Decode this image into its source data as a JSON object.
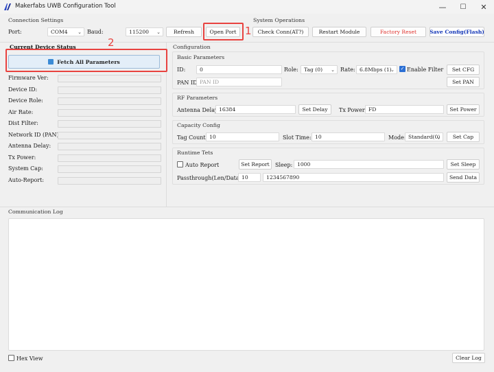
{
  "window": {
    "title": "Makerfabs UWB Configuration Tool",
    "controls": {
      "minimize": "—",
      "maximize": "☐",
      "close": "✕"
    }
  },
  "connection": {
    "section": "Connection Settings",
    "port_label": "Port:",
    "port_value": "COM4",
    "baud_label": "Baud:",
    "baud_value": "115200",
    "refresh": "Refresh",
    "open_port": "Open Port"
  },
  "system": {
    "section": "System Operations",
    "check_conn": "Check Conn(AT?)",
    "restart": "Restart Module",
    "factory_reset": "Factory Reset",
    "save_config": "Save Config(Flash)"
  },
  "status": {
    "section": "Current Device Status",
    "fetch_button": "Fetch All Parameters",
    "rows": [
      {
        "label": "Firmware Ver:"
      },
      {
        "label": "Device ID:"
      },
      {
        "label": "Device Role:"
      },
      {
        "label": "Air Rate:"
      },
      {
        "label": "Dist Filter:"
      },
      {
        "label": "Network ID (PAN):"
      },
      {
        "label": "Antenna Delay:"
      },
      {
        "label": "Tx Power:"
      },
      {
        "label": "System Cap:"
      },
      {
        "label": "Auto-Report:"
      }
    ]
  },
  "config": {
    "section": "Configuration",
    "basic": {
      "title": "Basic Parameters",
      "id_label": "ID:",
      "id_value": "0",
      "role_label": "Role:",
      "role_value": "Tag (0)",
      "rate_label": "Rate:",
      "rate_value": "6.8Mbps (1)",
      "filter_label": "Enable Filter",
      "filter_checked": true,
      "set_cfg": "Set CFG",
      "pan_label": "PAN ID:",
      "pan_placeholder": "PAN ID",
      "set_pan": "Set PAN"
    },
    "rf": {
      "title": "RF Parameters",
      "delay_label": "Antenna Delay:",
      "delay_value": "16384",
      "set_delay": "Set Delay",
      "power_label": "Tx Power:",
      "power_value": "FD",
      "set_power": "Set Power"
    },
    "capacity": {
      "title": "Capacity Config",
      "tag_label": "Tag Count:",
      "tag_value": "10",
      "slot_label": "Slot Time:",
      "slot_value": "10",
      "mode_label": "Mode:",
      "mode_value": "Standard(0)",
      "set_cap": "Set Cap"
    },
    "runtime": {
      "title": "Runtime Tets",
      "auto_label": "Auto Report",
      "auto_checked": false,
      "set_report": "Set Report",
      "sleep_label": "Sleep:",
      "sleep_value": "1000",
      "set_sleep": "Set Sleep",
      "pass_label": "Passthrough(Len/Data):",
      "pass_len": "10",
      "pass_data": "1234567890",
      "send_data": "Send Data"
    }
  },
  "log": {
    "section": "Communication Log",
    "hex_label": "Hex View",
    "clear": "Clear Log"
  },
  "annotations": {
    "one": "1",
    "two": "2",
    "color": "#e8423f"
  }
}
